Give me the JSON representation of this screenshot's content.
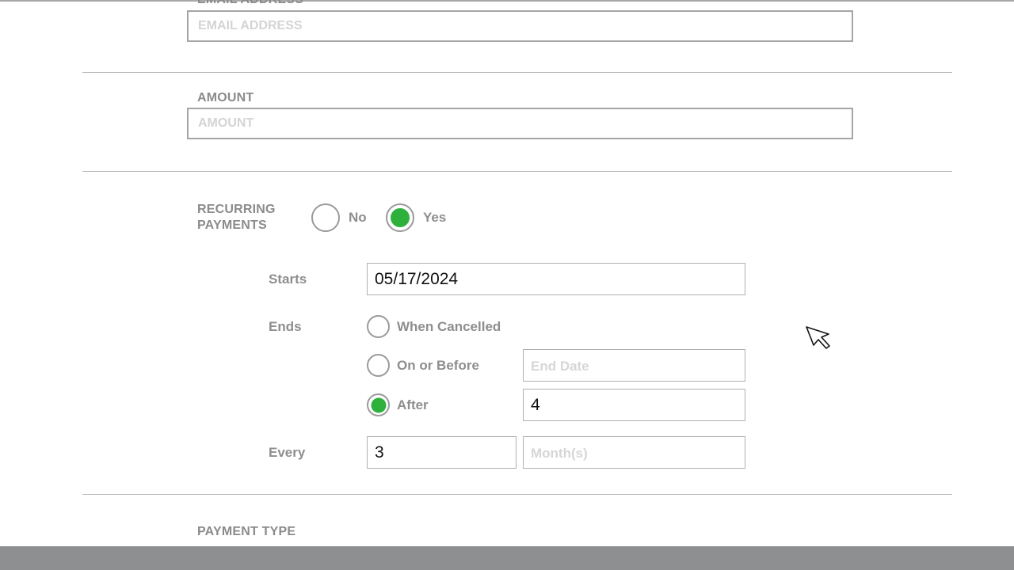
{
  "form": {
    "email": {
      "label": "EMAIL ADDRESS",
      "placeholder": "EMAIL ADDRESS",
      "value": ""
    },
    "amount": {
      "label": "AMOUNT",
      "placeholder": "AMOUNT",
      "value": ""
    },
    "recurring": {
      "label_line1": "RECURRING",
      "label_line2": "PAYMENTS",
      "options": [
        {
          "label": "No",
          "selected": false
        },
        {
          "label": "Yes",
          "selected": true
        }
      ]
    },
    "starts": {
      "label": "Starts",
      "value": "05/17/2024"
    },
    "ends": {
      "label": "Ends",
      "options": [
        {
          "label": "When Cancelled",
          "selected": false
        },
        {
          "label": "On or Before",
          "selected": false,
          "input_placeholder": "End Date",
          "input_value": ""
        },
        {
          "label": "After",
          "selected": true,
          "input_value": "4"
        }
      ]
    },
    "every": {
      "label": "Every",
      "value": "3",
      "unit_placeholder": "Month(s)",
      "unit_value": ""
    },
    "payment_type": {
      "label": "PAYMENT TYPE"
    }
  },
  "colors": {
    "accent_green": "#2eb03c",
    "label_gray": "#8b8b8b",
    "bottom_bar": "#8e8f91"
  },
  "icons": {
    "cursor": "mouse-pointer-icon"
  }
}
